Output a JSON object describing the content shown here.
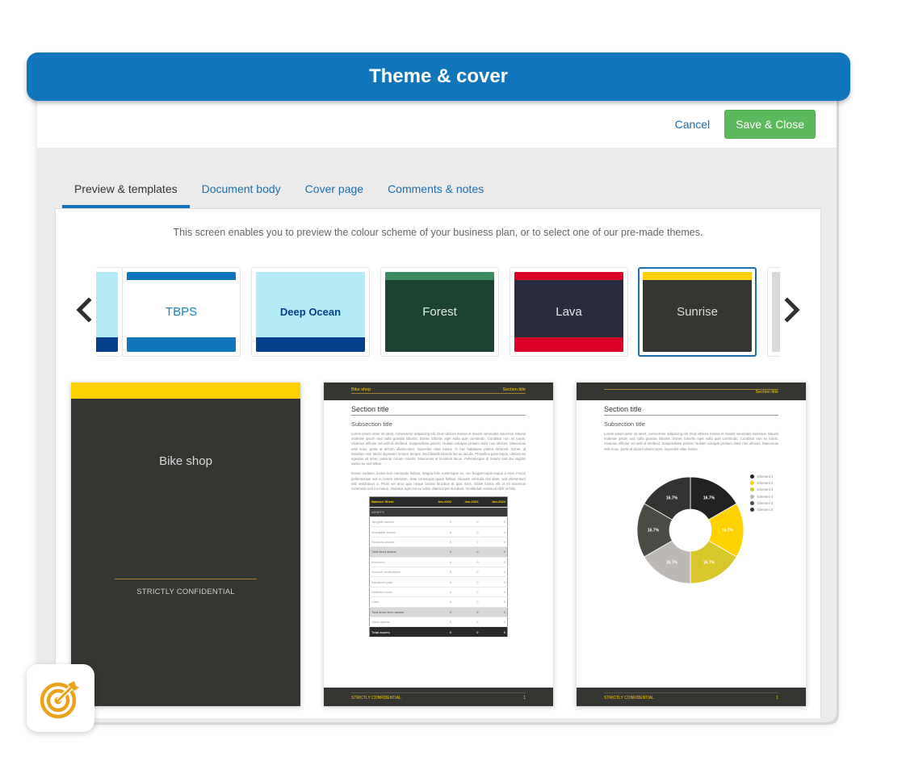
{
  "modal": {
    "title": "Theme & cover",
    "cancel_label": "Cancel",
    "save_label": "Save & Close"
  },
  "tabs": [
    {
      "label": "Preview & templates",
      "active": true
    },
    {
      "label": "Document body",
      "active": false
    },
    {
      "label": "Cover page",
      "active": false
    },
    {
      "label": "Comments & notes",
      "active": false
    }
  ],
  "intro_text": "This screen enables you to preview the colour scheme of your business plan, or to select one of our pre-made themes.",
  "themes": [
    {
      "name": "",
      "bg": "#b3ebf7",
      "top": "#b3ebf7",
      "bottom": "#043f8b",
      "text": "#043f8b",
      "partial": true
    },
    {
      "name": "TBPS",
      "bg": "#ffffff",
      "top": "#1175bb",
      "bottom": "#1175bb",
      "text": "#1b7fc0"
    },
    {
      "name": "Deep Ocean",
      "bg": "#b3ebf7",
      "top": "#b3ebf7",
      "bottom": "#043f8b",
      "text": "#043f8b"
    },
    {
      "name": "Forest",
      "bg": "#1c4332",
      "top": "#3c8a5f",
      "bottom": "#1c4332",
      "text": "#e4efe8"
    },
    {
      "name": "Lava",
      "bg": "#2b2b40",
      "top": "#da0028",
      "bottom": "#da0028",
      "text": "#e8e8e8"
    },
    {
      "name": "Sunrise",
      "bg": "#353632",
      "top": "#ffd100",
      "bottom": "#353632",
      "text": "#dcdcdc",
      "selected": true
    },
    {
      "name": "",
      "bg": "#d9d9d9",
      "top": "#d9d9d9",
      "bottom": "#d9d9d9",
      "text": "#222",
      "partial": true
    }
  ],
  "cover_preview": {
    "title": "Bike shop",
    "confidential": "STRICTLY CONFIDENTIAL",
    "accent": "#ffd100"
  },
  "doc_preview": {
    "header_left": "Bike shop",
    "header_right": "Section title",
    "section_title": "Section title",
    "subsection_title": "Subsection title",
    "para1": "Lorem ipsum dolor sit amet, consectetur adipiscing elit. Duis ultrices massa et mauris venenatis maximus. Mauris molestie ipsum sed nulla gravida lobortis. Donec lobortis eget nulla quis commodo. Curabitur non ex turpis. Vivamus efficitur vel velit id eleifend. Suspendisse potenti. Nullam volutpat pretium dolor non ultrices. Maecenas velit nunc, porta at dictum ullamcorper, imperdiet vitae metus. In hac habitasse platea dictumst. Donec id interdum nisl. Morbi dignissim tempor tempor. Sed blandit lobortis leo ac iaculis. Phasellus justo turpis, ultrices eu egestas sit amet, pulvinar ornare mauris. Maecenas et tincidunt lacus. Pellentesque id mauris sed dui sagittis varius eu sed tellus.",
    "para2": "Donec sodales, lectus non commodo finibus, magna felis scelerisque ex, nec feugiat turpis neque a eros. Fusce pellentesque nisl eu lorem interdum, vitae consequat quam finibus. Aliquam vehicula nisl diam, sed elementum nisl vestibulum a. Proin vel arcu quis neque lacinia faucibus at quis nunc. Etiam luctus elit ut mi maximus commodo sed eu metus. Vivamus eget est eu tellus ullamcorper tincidunt. Vestibulum euismod nibh ut felis.",
    "para_short": "Lorem ipsum dolor sit amet, consectetur adipiscing elit. Duis ultrices massa et mauris venenatis maximus. Mauris molestie ipsum sed nulla gravida lobortis. Donec lobortis eget nulla quis commodo. Curabitur non ex turpis. Vivamus efficitur vel velit id eleifend. Suspendisse potenti. Nullam volutpat pretium dolor non ultrices. Maecenas velit nunc, porta at dictum ullamcorper, imperdiet vitae metus.",
    "footer_left": "STRICTLY CONFIDENTIAL",
    "footer_right": "1",
    "balance_sheet": {
      "headers": [
        "Balance Sheet",
        "Jan-2022",
        "Jan-2023",
        "Jan-2024"
      ],
      "rows": [
        {
          "type": "sect",
          "cells": [
            "ASSETS",
            "",
            "",
            ""
          ]
        },
        {
          "type": "row",
          "cells": [
            "Tangible assets",
            "0",
            "0",
            "0"
          ]
        },
        {
          "type": "row",
          "cells": [
            "Intangible assets",
            "0",
            "0",
            "0"
          ]
        },
        {
          "type": "row",
          "cells": [
            "Financial assets",
            "0",
            "0",
            "0"
          ]
        },
        {
          "type": "sub",
          "cells": [
            "Total fixed assets",
            "0",
            "0",
            "0"
          ]
        },
        {
          "type": "row",
          "cells": [
            "Inventory",
            "0",
            "0",
            "0"
          ]
        },
        {
          "type": "row",
          "cells": [
            "Account receivables",
            "0",
            "0",
            "0"
          ]
        },
        {
          "type": "row",
          "cells": [
            "Advances paid",
            "0",
            "0",
            "0"
          ]
        },
        {
          "type": "row",
          "cells": [
            "Deferred costs",
            "0",
            "0",
            "0"
          ]
        },
        {
          "type": "row",
          "cells": [
            "Cash",
            "0",
            "0",
            "0"
          ]
        },
        {
          "type": "sub",
          "cells": [
            "Total short term assets",
            "0",
            "0",
            "0"
          ]
        },
        {
          "type": "row",
          "cells": [
            "Other assets",
            "0",
            "0",
            "0"
          ]
        },
        {
          "type": "tot",
          "cells": [
            "Total assets",
            "0",
            "0",
            "0"
          ]
        }
      ]
    },
    "donut": {
      "slices": [
        {
          "label": "Element 1",
          "value": 16.7,
          "display": "16.7%",
          "color": "#222222"
        },
        {
          "label": "Element 2",
          "value": 16.7,
          "display": "16.7%",
          "color": "#ffd100"
        },
        {
          "label": "Element 3",
          "value": 16.7,
          "display": "16.7%",
          "color": "#d8c62a"
        },
        {
          "label": "Element 4",
          "value": 16.7,
          "display": "16.7%",
          "color": "#bcb8b6"
        },
        {
          "label": "Element 5",
          "value": 16.7,
          "display": "16.7%",
          "color": "#4a4b44"
        },
        {
          "label": "Element 6",
          "value": 16.7,
          "display": "16.7%",
          "color": "#333431"
        }
      ]
    }
  }
}
